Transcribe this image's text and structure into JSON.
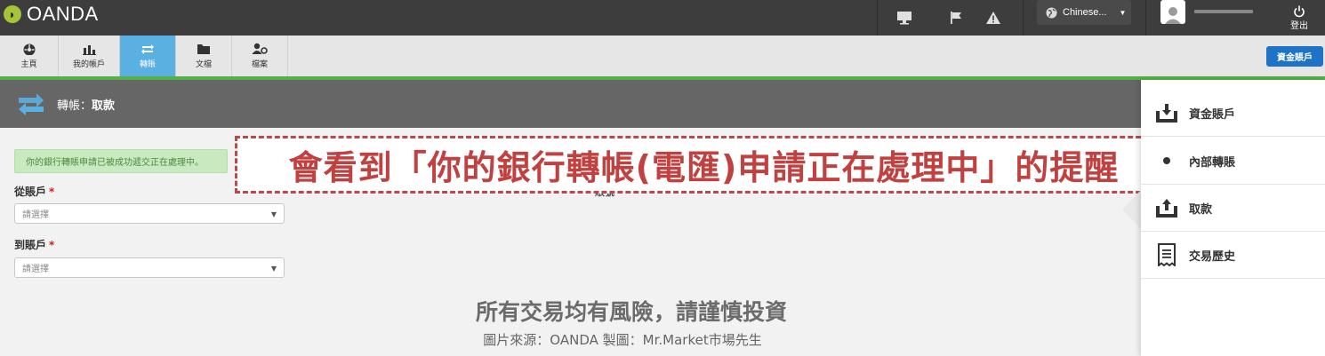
{
  "topbar": {
    "logo_text": "OANDA",
    "language": "Chinese...",
    "logout_label": "登出"
  },
  "nav": {
    "items": [
      {
        "label": "主頁"
      },
      {
        "label": "我的帳戶"
      },
      {
        "label": "轉賬"
      },
      {
        "label": "文檔"
      },
      {
        "label": "檔案"
      }
    ],
    "fund_button": "資金賬戶"
  },
  "page": {
    "title_prefix": "轉帳：",
    "title_main": "取款"
  },
  "alert": {
    "text": "你的銀行轉賬申請已被成功遞交正在處理中。"
  },
  "form": {
    "from_label": "從賬戶",
    "to_label": "到賬戶",
    "required_mark": "*",
    "from_placeholder": "請選擇",
    "to_placeholder": "請選擇",
    "partial_text": "賬號"
  },
  "banner": {
    "text": "會看到「你的銀行轉帳(電匯)申請正在處理中」的提醒"
  },
  "footer": {
    "risk_text": "所有交易均有風險，請謹慎投資",
    "credit_text": "圖片來源：OANDA 製圖：Mr.Market市場先生"
  },
  "sidepanel": {
    "items": [
      {
        "label": "資金賬戶"
      },
      {
        "label": "內部轉賬"
      },
      {
        "label": "取款"
      },
      {
        "label": "交易歷史"
      }
    ]
  },
  "colors": {
    "accent": "#5ab0e0",
    "green_bar": "#53b148",
    "banner_red": "#c0413f",
    "fund_blue": "#1f73c6"
  }
}
